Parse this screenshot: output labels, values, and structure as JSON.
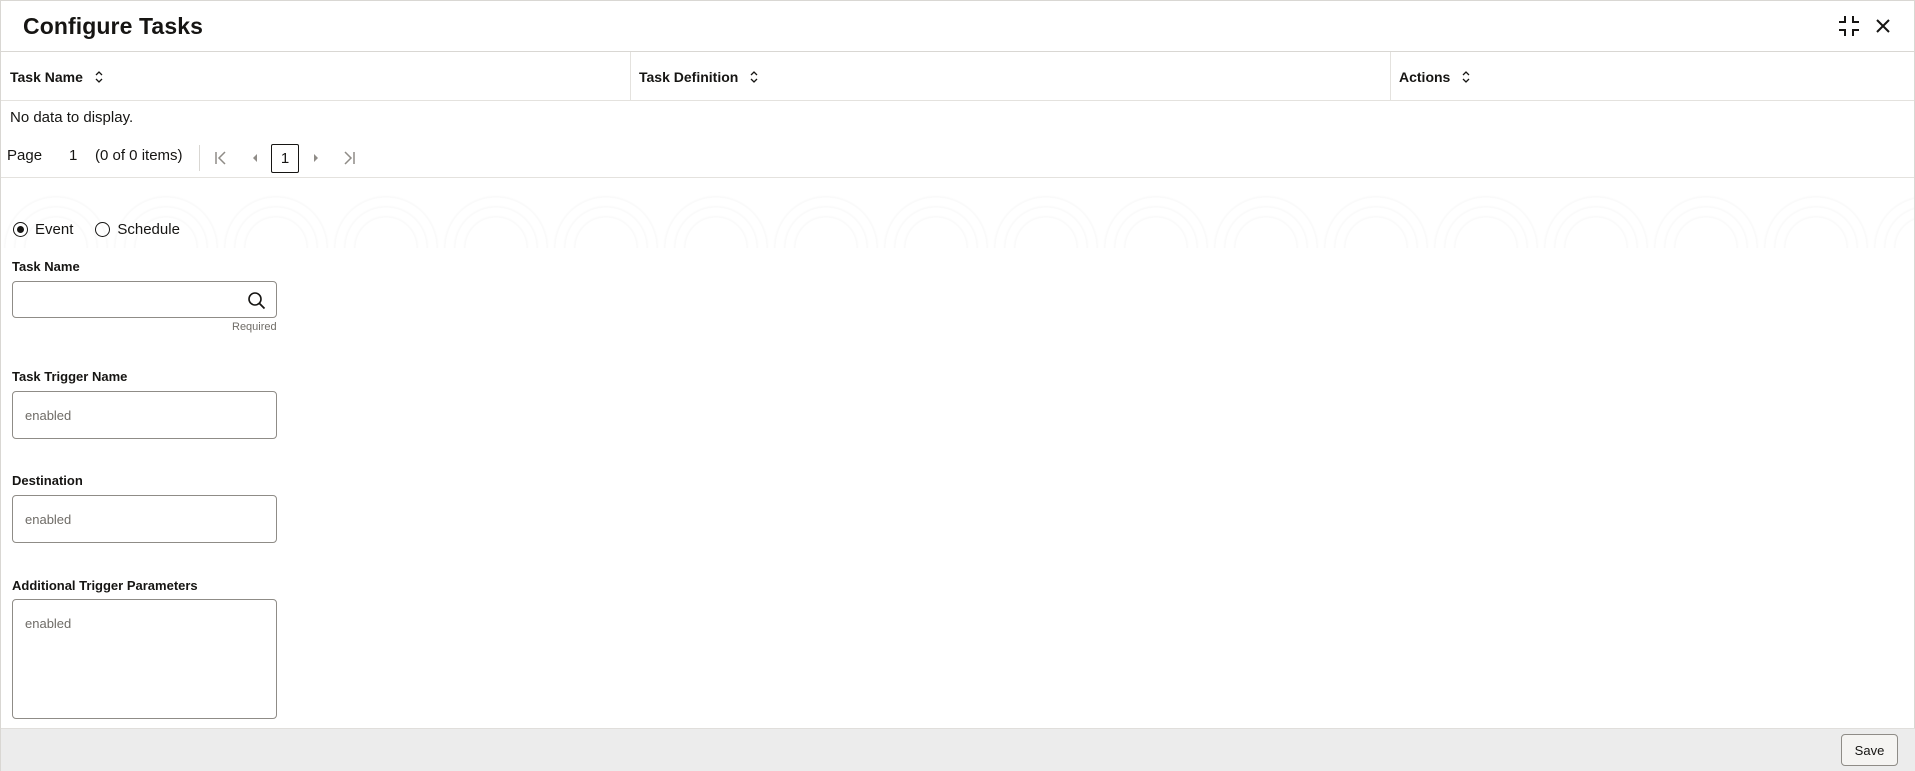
{
  "dialog": {
    "title": "Configure Tasks"
  },
  "header_actions": {
    "restore_icon": "collapse-icon",
    "close_icon": "close-icon"
  },
  "table": {
    "columns": [
      {
        "label": "Task Name"
      },
      {
        "label": "Task Definition"
      },
      {
        "label": "Actions"
      }
    ],
    "empty_message": "No data to display."
  },
  "pager": {
    "page_label": "Page",
    "page_value": "1",
    "items_summary": "(0 of 0 items)",
    "current_page": "1"
  },
  "form": {
    "trigger_type": {
      "options": [
        {
          "label": "Event",
          "selected": true
        },
        {
          "label": "Schedule",
          "selected": false
        }
      ]
    },
    "task_name": {
      "label": "Task Name",
      "value": "",
      "help": "Required"
    },
    "task_trigger_name": {
      "label": "Task Trigger Name",
      "placeholder": "enabled"
    },
    "destination": {
      "label": "Destination",
      "placeholder": "enabled"
    },
    "additional_params": {
      "label": "Additional Trigger Parameters",
      "placeholder": "enabled"
    }
  },
  "footer": {
    "save_label": "Save"
  },
  "colors": {
    "text": "#161513",
    "border": "#8f8c87",
    "footer_bg": "#ececec"
  }
}
